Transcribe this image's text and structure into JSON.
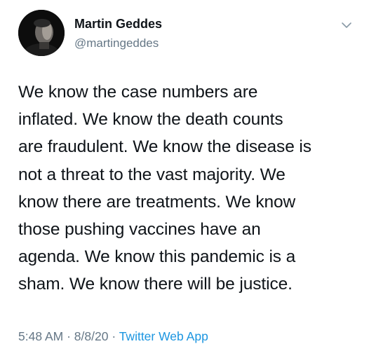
{
  "author": {
    "display_name": "Martin Geddes",
    "handle": "@martingeddes"
  },
  "tweet": {
    "lines": [
      "We know the case numbers are",
      "inflated. We know the death counts",
      "are fraudulent. We know the disease is",
      "not a threat to the vast majority. We",
      "know there are treatments. We know",
      "those pushing vaccines have an",
      "agenda. We know this pandemic is a",
      "sham. We know there will be justice."
    ],
    "time": "5:48 AM",
    "separator": "·",
    "date": "8/8/20",
    "source_app": "Twitter Web App"
  },
  "icons": {
    "menu": "chevron-down-icon",
    "avatar": "avatar"
  },
  "colors": {
    "text": "#0f1419",
    "secondary": "#657786",
    "link": "#1b95e0",
    "background": "#ffffff"
  }
}
